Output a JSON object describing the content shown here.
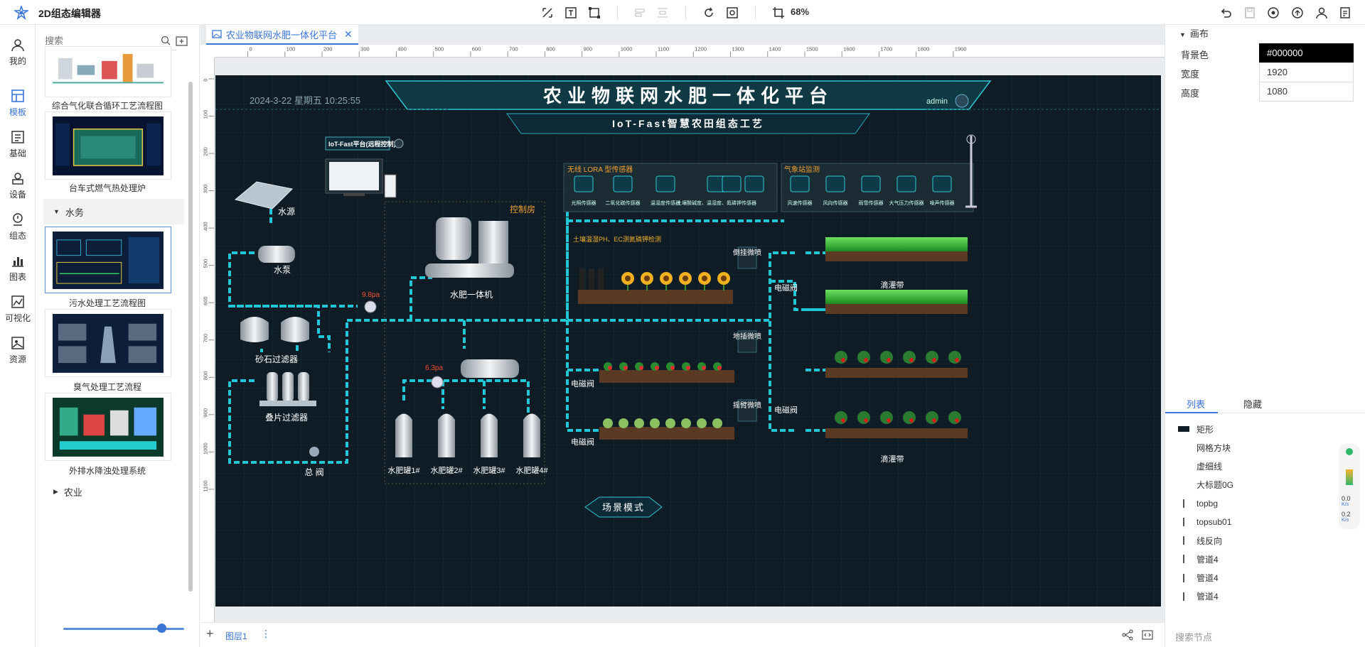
{
  "app": {
    "title": "2D组态编辑器",
    "zoom": "68%"
  },
  "leftnav": [
    {
      "label": "我的",
      "icon": "user-icon"
    },
    {
      "label": "模板",
      "icon": "template-icon"
    },
    {
      "label": "基础",
      "icon": "basic-shapes-icon"
    },
    {
      "label": "设备",
      "icon": "device-icon"
    },
    {
      "label": "组态",
      "icon": "config-icon"
    },
    {
      "label": "图表",
      "icon": "chart-icon"
    },
    {
      "label": "可视化",
      "icon": "visualization-icon"
    },
    {
      "label": "资源",
      "icon": "resource-icon"
    }
  ],
  "templates": {
    "search_placeholder": "搜索",
    "items": [
      {
        "label": "综合气化联合循环工艺流程图"
      },
      {
        "label": "台车式燃气热处理炉"
      },
      {
        "label": "污水处理工艺流程图"
      },
      {
        "label": "臭气处理工艺流程"
      },
      {
        "label": "外排水降浊处理系统"
      }
    ],
    "categories": {
      "water": "水务",
      "agri": "农业"
    }
  },
  "tab": {
    "label": "农业物联网水肥一体化平台"
  },
  "ruler_top": [
    "0",
    "100",
    "200",
    "300",
    "400",
    "500",
    "600",
    "700",
    "800",
    "900",
    "1000",
    "1100",
    "1200",
    "1300",
    "1400",
    "1500",
    "1600",
    "1700",
    "1800",
    "1900"
  ],
  "ruler_left": [
    "0",
    "100",
    "200",
    "300",
    "400",
    "500",
    "600",
    "700",
    "800",
    "900",
    "1000",
    "1100"
  ],
  "bottom": {
    "layer_label": "图层1"
  },
  "scada": {
    "title": "农业物联网水肥一体化平台",
    "subtitle": "IoT-Fast智慧农田组态工艺",
    "datetime": "2024-3-22 星期五 10:25:55",
    "user": "admin",
    "remote_label": "IoT-Fast平台(远程控制)",
    "control_room": "控制房",
    "water_source": "水源",
    "water_pump": "水泵",
    "sand_filter": "砂石过滤器",
    "disc_filter": "叠片过滤器",
    "main_valve": "总 阀",
    "fertigation": "水肥一体机",
    "pressure1": "9.8pa",
    "pressure2": "6.3pa",
    "tanks": [
      "水肥罐1#",
      "水肥罐2#",
      "水肥罐3#",
      "水肥罐4#"
    ],
    "lora_title": "无线 LORA 型传感器",
    "lora_sensors": [
      "光照传感器",
      "二氧化碳传感器",
      "温湿度传感器",
      "土壤酸碱度、温湿度、氮磷钾传感器"
    ],
    "weather_title": "气象站监测",
    "weather_sensors": [
      "风速传感器",
      "风向传感器",
      "雨雪传感器",
      "大气压力传感器",
      "噪声传感器"
    ],
    "soil_label": "土壤温湿PH、EC测氮磷钾检测",
    "spray1": "倒挂微喷",
    "spray2": "地插微喷",
    "spray3": "摇臂微喷",
    "valve": "电磁阀",
    "drip": "滴灌带",
    "scene": "场景模式"
  },
  "props": {
    "section": "画布",
    "bg_label": "背景色",
    "bg_value": "#000000",
    "w_label": "宽度",
    "w_value": "1920",
    "h_label": "高度",
    "h_value": "1080"
  },
  "layers": {
    "tab_list": "列表",
    "tab_hidden": "隐藏",
    "items": [
      "矩形",
      "网格方块",
      "虚细线",
      "大标题0G",
      "topbg",
      "topsub01",
      "线反向",
      "管道4",
      "管道4",
      "管道4"
    ],
    "search_placeholder": "搜索节点"
  },
  "net": {
    "up": "0.0",
    "up_unit": "K/s",
    "down": "0.2",
    "down_unit": "K/s"
  },
  "colors": {
    "accent": "#3a75d8",
    "scada_bg": "#0f1c25",
    "pipe": "#22c7d6",
    "title": "#ffffff"
  }
}
